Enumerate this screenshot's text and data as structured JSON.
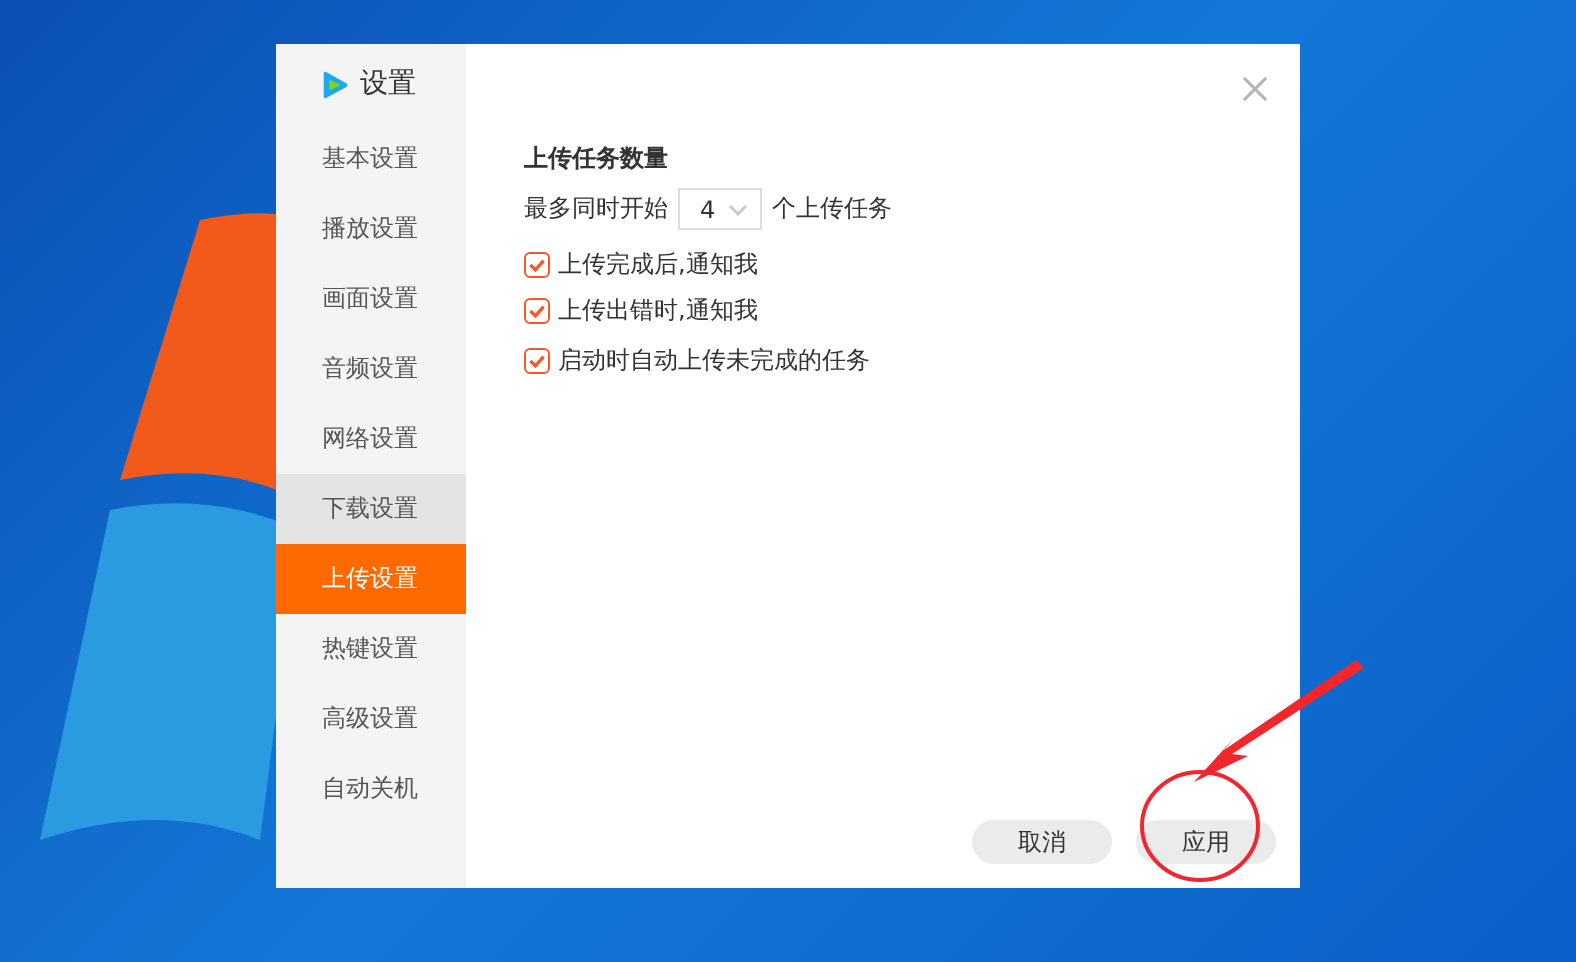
{
  "window": {
    "title": "设置"
  },
  "sidebar": {
    "items": [
      {
        "label": "基本设置",
        "selected": false,
        "hovered": false
      },
      {
        "label": "播放设置",
        "selected": false,
        "hovered": false
      },
      {
        "label": "画面设置",
        "selected": false,
        "hovered": false
      },
      {
        "label": "音频设置",
        "selected": false,
        "hovered": false
      },
      {
        "label": "网络设置",
        "selected": false,
        "hovered": false
      },
      {
        "label": "下载设置",
        "selected": false,
        "hovered": true
      },
      {
        "label": "上传设置",
        "selected": true,
        "hovered": false
      },
      {
        "label": "热键设置",
        "selected": false,
        "hovered": false
      },
      {
        "label": "高级设置",
        "selected": false,
        "hovered": false
      },
      {
        "label": "自动关机",
        "selected": false,
        "hovered": false
      }
    ]
  },
  "section": {
    "heading": "上传任务数量",
    "limit_row": {
      "prefix": "最多同时开始",
      "value": "4",
      "suffix": "个上传任务"
    },
    "options": [
      {
        "label": "上传完成后,通知我",
        "checked": true
      },
      {
        "label": "上传出错时,通知我",
        "checked": true
      },
      {
        "label": "启动时自动上传未完成的任务",
        "checked": true
      }
    ]
  },
  "buttons": [
    {
      "label": "取消"
    },
    {
      "label": "应用"
    }
  ]
}
